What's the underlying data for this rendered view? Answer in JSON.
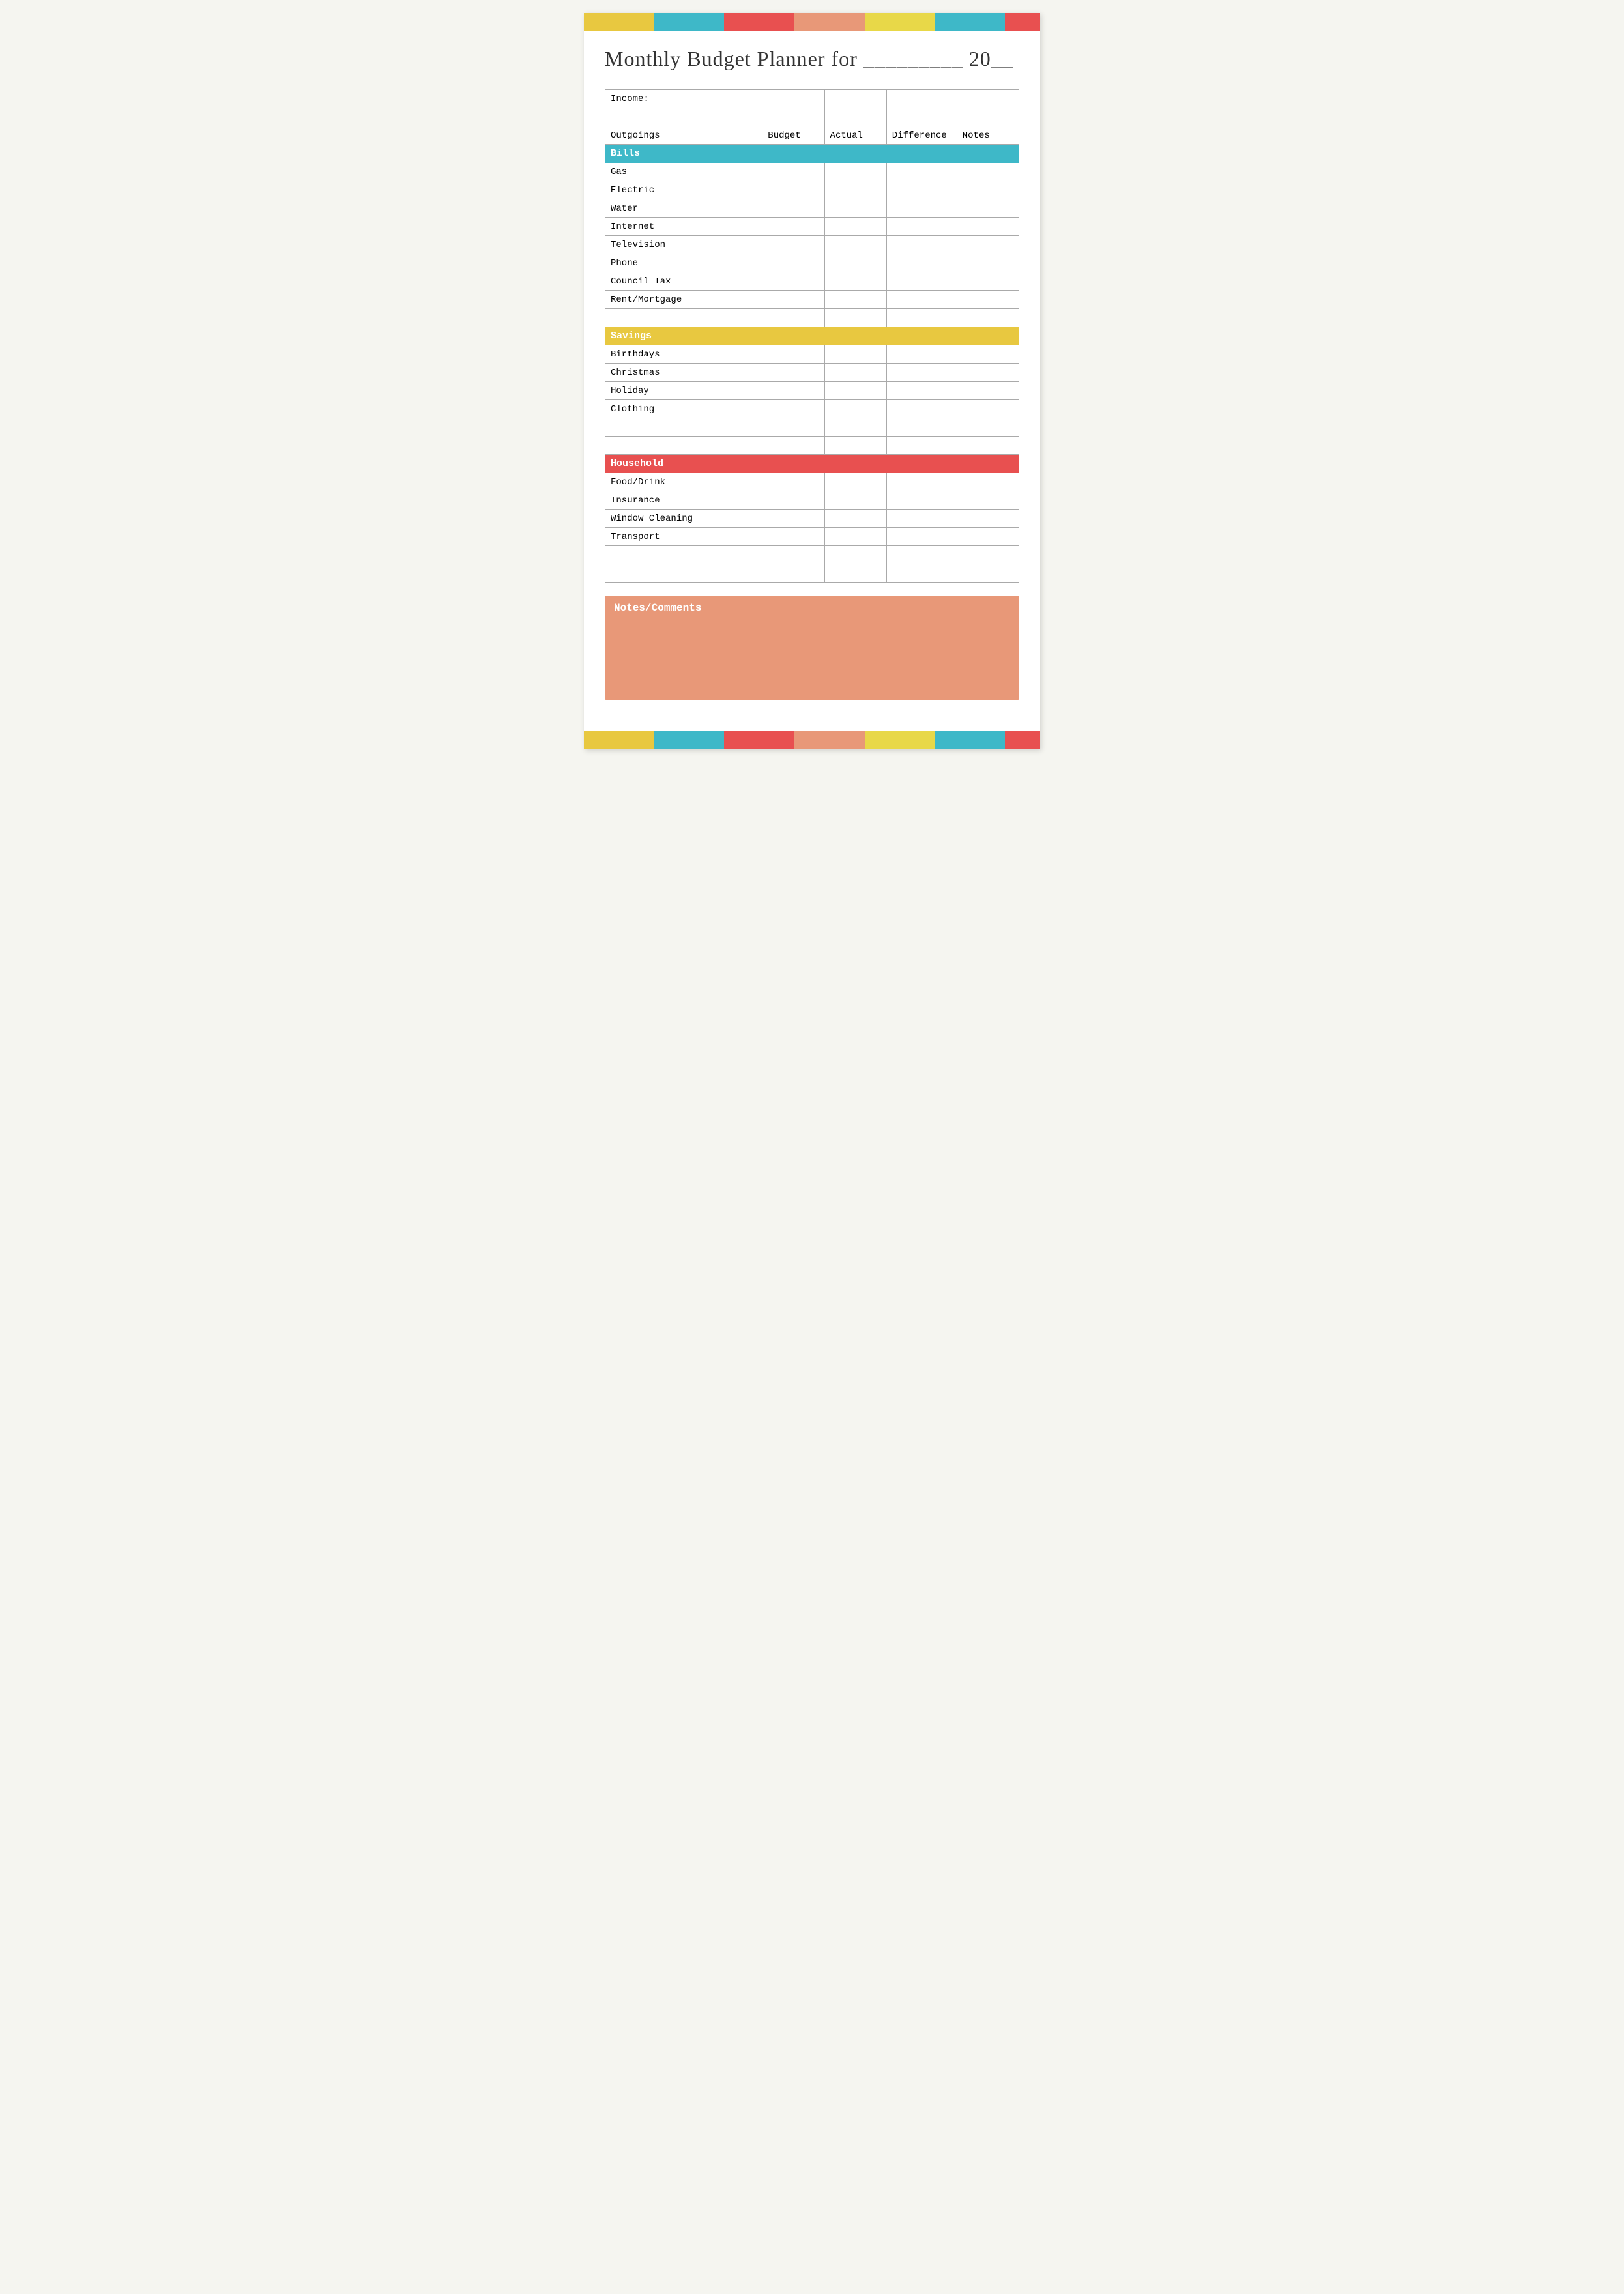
{
  "title": "Monthly Budget Planner for _________ 20__",
  "table": {
    "income_label": "Income:",
    "columns": {
      "outgoings": "Outgoings",
      "budget": "Budget",
      "actual": "Actual",
      "difference": "Difference",
      "notes": "Notes"
    },
    "categories": [
      {
        "name": "Bills",
        "color": "bills",
        "rows": [
          "Gas",
          "Electric",
          "Water",
          "Internet",
          "Television",
          "Phone",
          "Council Tax",
          "Rent/Mortgage"
        ]
      },
      {
        "name": "Savings",
        "color": "savings",
        "rows": [
          "Birthdays",
          "Christmas",
          "Holiday",
          "Clothing"
        ]
      },
      {
        "name": "Household",
        "color": "household",
        "rows": [
          "Food/Drink",
          "Insurance",
          "Window Cleaning",
          "Transport"
        ]
      }
    ]
  },
  "notes_section": {
    "title": "Notes/Comments"
  },
  "color_bars": {
    "segments": [
      "yellow",
      "teal",
      "red",
      "salmon",
      "yellow",
      "teal",
      "red"
    ]
  }
}
